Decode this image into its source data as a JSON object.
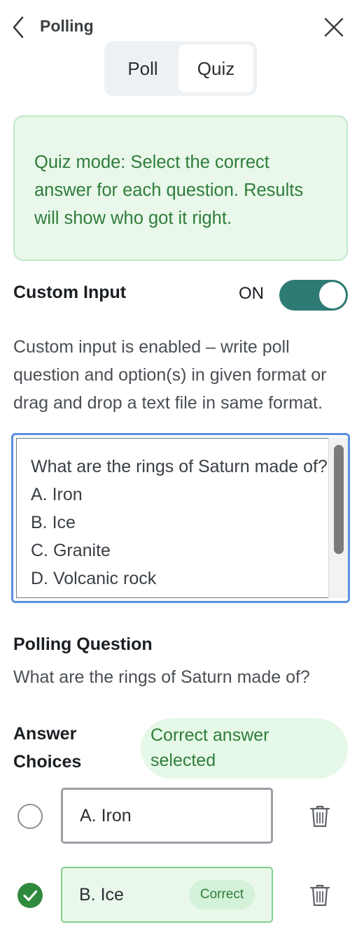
{
  "header": {
    "title": "Polling"
  },
  "tabs": {
    "poll_label": "Poll",
    "quiz_label": "Quiz",
    "active": "Quiz"
  },
  "info": {
    "text": "Quiz mode: Select the correct answer for each question. Results will show who got it right."
  },
  "custom_input": {
    "label": "Custom Input",
    "toggle_state": "ON",
    "description": "Custom input is enabled – write poll question and option(s) in given format or drag and drop a text file in same format.",
    "text": "What are the rings of Saturn made of?\nA. Iron\nB. Ice\nC. Granite\nD. Volcanic rock"
  },
  "polling_question": {
    "label": "Polling Question",
    "value": "What are the rings of Saturn made of?"
  },
  "answer_choices": {
    "label": "Answer Choices",
    "status_badge": "Correct answer selected",
    "items": [
      {
        "text": "A. Iron",
        "selected": false
      },
      {
        "text": "B. Ice",
        "selected": true,
        "tag": "Correct"
      }
    ]
  },
  "colors": {
    "accent_green": "#2f8a3e",
    "toggle_teal": "#2e7a74",
    "focus_blue": "#5b8fe0"
  }
}
